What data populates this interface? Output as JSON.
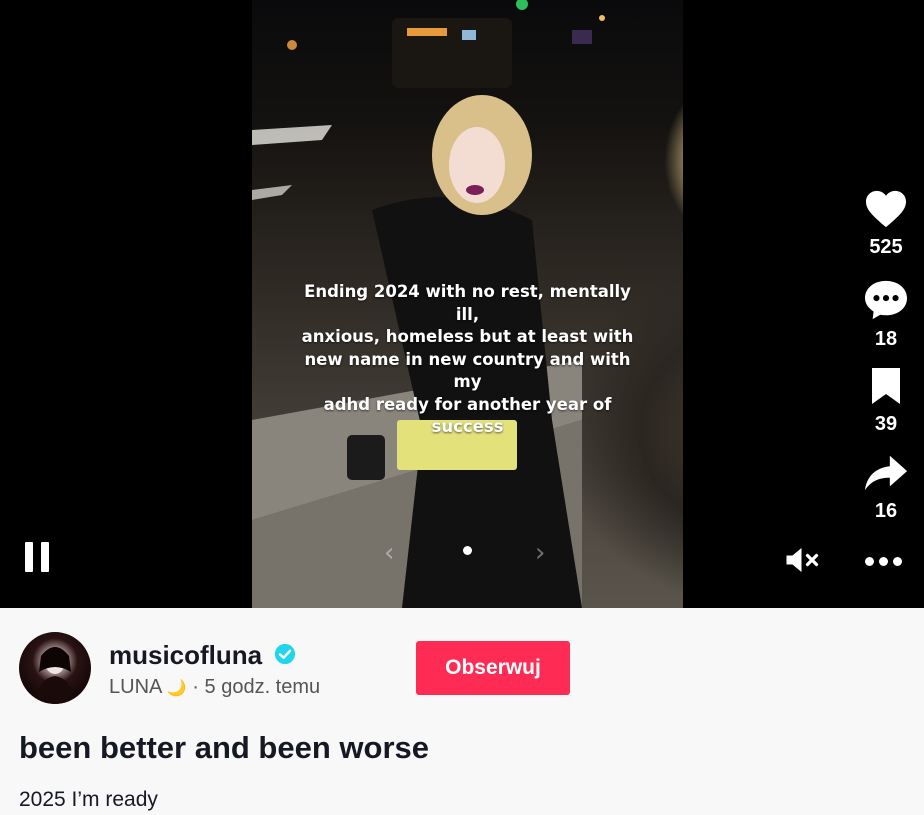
{
  "video": {
    "caption_lines": [
      "Ending 2024 with no rest, mentally ill,",
      "anxious, homeless but at least with",
      "new name in new country and with my",
      "adhd ready for another year of success"
    ],
    "nav_prev_glyph": "‹",
    "nav_next_glyph": "›"
  },
  "actions": {
    "likes": "525",
    "comments": "18",
    "saves": "39",
    "shares": "16",
    "icons": [
      "heart-icon",
      "comment-icon",
      "bookmark-icon",
      "share-icon",
      "mute-icon",
      "more-icon",
      "pause-icon"
    ]
  },
  "author": {
    "username": "musicofluna",
    "display_name": "LUNA",
    "emoji": "🌙",
    "time_ago": "· 5 godz. temu",
    "verified": true
  },
  "follow_label": "Obserwuj",
  "post": {
    "title": "been better and been worse",
    "description": "2025 I’m ready"
  },
  "colors": {
    "accent": "#fe2c55",
    "verified": "#20d5ec"
  }
}
